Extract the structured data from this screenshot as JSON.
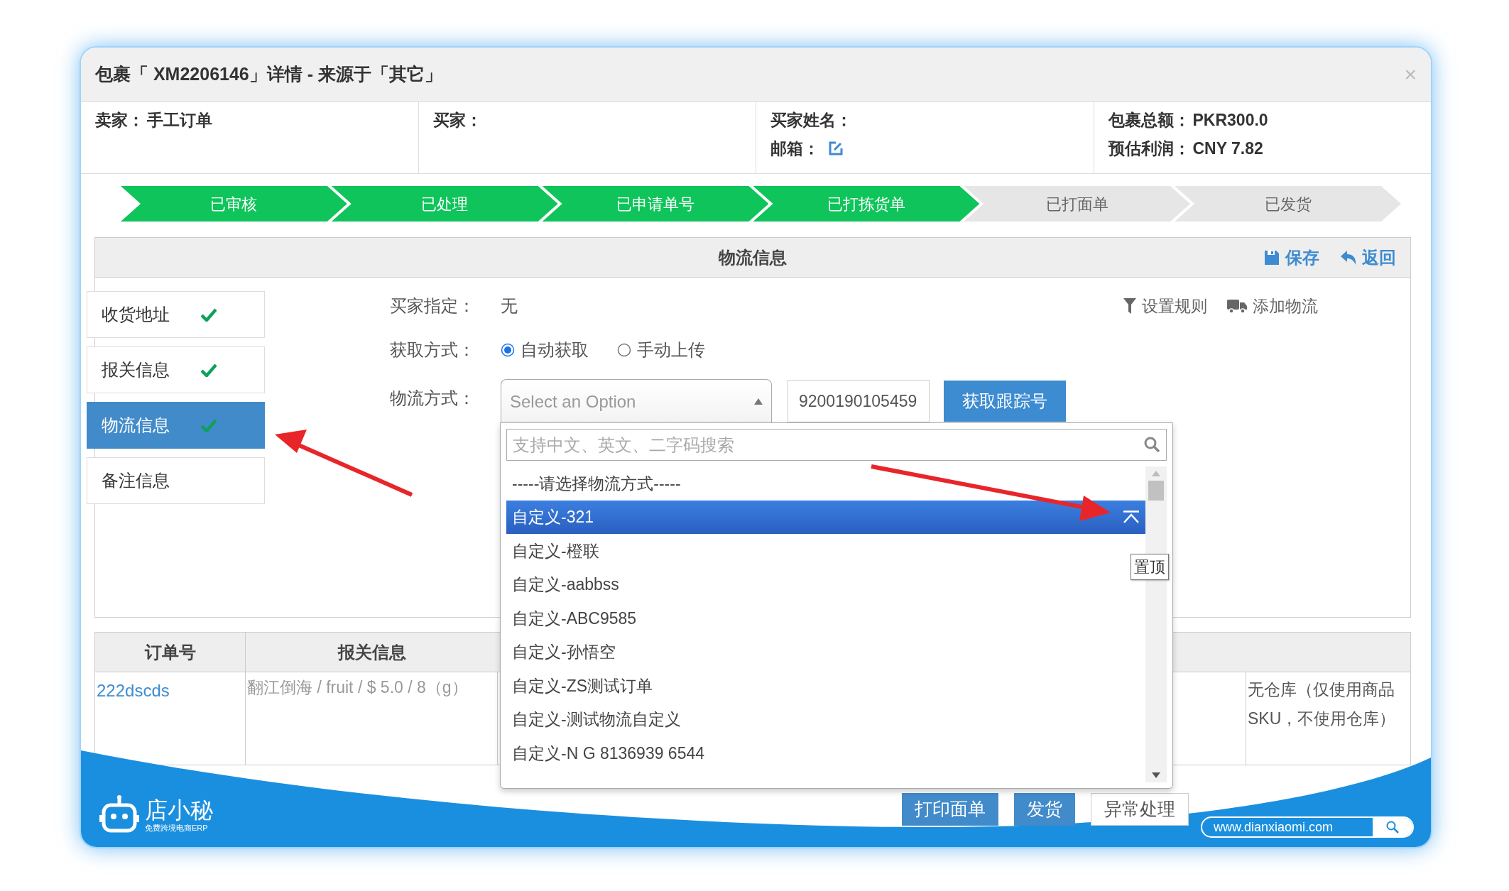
{
  "window": {
    "title": "包裹「 XM2206146」详情 - 来源于「其它」",
    "close": "×"
  },
  "info_columns": [
    [
      {
        "label": "卖家：",
        "value": "手工订单"
      }
    ],
    [
      {
        "label": "买家："
      }
    ],
    [
      {
        "label": "买家姓名："
      },
      {
        "label": "邮箱：",
        "kind": "editable"
      }
    ],
    [
      {
        "label": "包裹总额：",
        "value": "PKR300.0"
      },
      {
        "label": "预估利润：",
        "value": "CNY 7.82"
      }
    ]
  ],
  "steps": [
    {
      "label": "已审核",
      "done": true
    },
    {
      "label": "已处理",
      "done": true
    },
    {
      "label": "已申请单号",
      "done": true
    },
    {
      "label": "已打拣货单",
      "done": true
    },
    {
      "label": "已打面单",
      "done": false
    },
    {
      "label": "已发货",
      "done": false
    }
  ],
  "panel": {
    "title": "物流信息",
    "actions": [
      {
        "label": "保存",
        "kind": "save"
      },
      {
        "label": "返回",
        "kind": "back"
      }
    ]
  },
  "side_tabs": [
    {
      "label": "收货地址",
      "checked": true,
      "selected": false
    },
    {
      "label": "报关信息",
      "checked": true,
      "selected": false
    },
    {
      "label": "物流信息",
      "checked": true,
      "selected": true
    },
    {
      "label": "备注信息",
      "checked": false,
      "selected": false
    }
  ],
  "form": {
    "buyer_specified": {
      "label": "买家指定：",
      "value": "无"
    },
    "tools": [
      {
        "label": "设置规则",
        "kind": "filter"
      },
      {
        "label": "添加物流",
        "kind": "truck"
      }
    ],
    "fetch_mode": {
      "label": "获取方式：",
      "options": [
        {
          "label": "自动获取",
          "selected": true
        },
        {
          "label": "手动上传",
          "selected": false
        }
      ]
    },
    "shipping": {
      "label": "物流方式：",
      "select_placeholder": "Select an Option",
      "tracking_value": "9200190105459",
      "button": "获取跟踪号"
    }
  },
  "dropdown": {
    "search_placeholder": "支持中文、英文、二字码搜索",
    "tooltip": "置顶",
    "items": [
      {
        "label": "-----请选择物流方式-----",
        "selected": false
      },
      {
        "label": "自定义-321",
        "selected": true
      },
      {
        "label": "自定义-橙联",
        "selected": false
      },
      {
        "label": "自定义-aabbss",
        "selected": false
      },
      {
        "label": "自定义-ABC9585",
        "selected": false
      },
      {
        "label": "自定义-孙悟空",
        "selected": false
      },
      {
        "label": "自定义-ZS测试订单",
        "selected": false
      },
      {
        "label": "自定义-测试物流自定义",
        "selected": false
      },
      {
        "label": "自定义-N G 8136939 6544",
        "selected": false
      }
    ]
  },
  "table": {
    "columns": [
      "订单号",
      "报关信息"
    ],
    "rows": [
      {
        "order": "222dscds",
        "customs": "翻江倒海 / fruit / $ 5.0 / 8（g）",
        "warehouse": "无仓库（仅使用商品SKU，不使用仓库）"
      }
    ]
  },
  "footer_buttons": [
    "打印面单",
    "发货",
    "异常处理"
  ],
  "banner": {
    "brand": "店小秘",
    "tagline": "免费跨境电商ERP",
    "url": "www.dianxiaomi.com"
  }
}
